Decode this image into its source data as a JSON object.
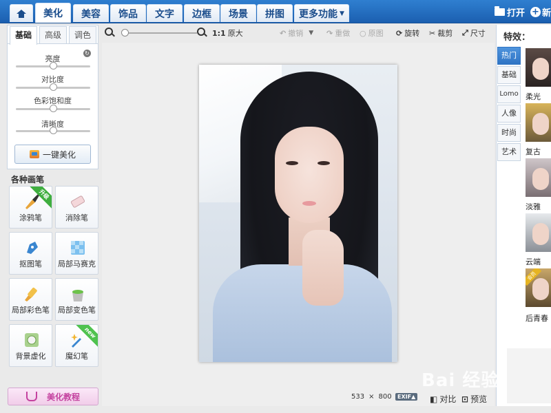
{
  "tabs": [
    {
      "label": "美化"
    },
    {
      "label": "美容"
    },
    {
      "label": "饰品"
    },
    {
      "label": "文字"
    },
    {
      "label": "边框"
    },
    {
      "label": "场景"
    },
    {
      "label": "拼图"
    },
    {
      "label": "更多功能"
    }
  ],
  "top_actions": {
    "open_label": "打开",
    "new_label": "新"
  },
  "left_tabs": [
    "基础",
    "高级",
    "调色"
  ],
  "sliders": [
    {
      "label": "亮度",
      "level": 0.5
    },
    {
      "label": "对比度",
      "level": 0.5
    },
    {
      "label": "色彩饱和度",
      "level": 0.5
    },
    {
      "label": "清晰度",
      "level": 0.5
    }
  ],
  "one_key_label": "一键美化",
  "brushes_title": "各种画笔",
  "brushes": [
    {
      "label": "涂鸦笔",
      "badge": "升级"
    },
    {
      "label": "消除笔",
      "badge": ""
    },
    {
      "label": "抠图笔",
      "badge": ""
    },
    {
      "label": "局部马赛克",
      "badge": ""
    },
    {
      "label": "局部彩色笔",
      "badge": ""
    },
    {
      "label": "局部变色笔",
      "badge": ""
    },
    {
      "label": "背景虚化",
      "badge": ""
    },
    {
      "label": "魔幻笔",
      "badge": "new"
    }
  ],
  "tutorial_label": "美化教程",
  "toolbar": {
    "ratio_label": "1:1",
    "original_size_label": "原大",
    "undo_label": "撤销",
    "redo_label": "重做",
    "original_label": "原图",
    "rotate_label": "旋转",
    "crop_label": "裁剪",
    "size_label": "尺寸"
  },
  "status": {
    "width": "533",
    "times": "×",
    "height": "800",
    "exif_label": "EXIF▲",
    "compare_label": "对比",
    "preview_label": "预览"
  },
  "effects": {
    "title": "特效：",
    "tabs": [
      "热门",
      "基础",
      "Lomo",
      "人像",
      "时尚",
      "艺术"
    ],
    "items": [
      {
        "label": "柔光"
      },
      {
        "label": "复古"
      },
      {
        "label": "淡雅"
      },
      {
        "label": "云端"
      },
      {
        "label": "后青春",
        "badge": "会员"
      }
    ]
  },
  "watermark_text": "Bai 经验",
  "colors": {
    "accent": "#1b5fb0",
    "active_effect_tab": "#2f74c4",
    "tutorial": "#c4429f"
  }
}
